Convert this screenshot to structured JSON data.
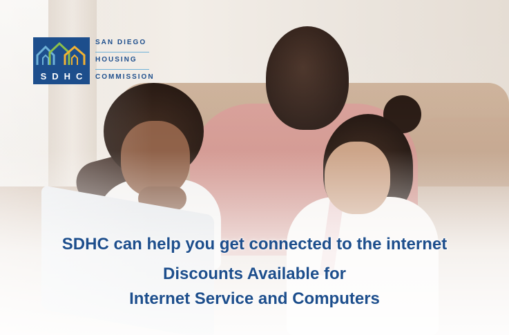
{
  "logo": {
    "letters": "SDHC",
    "line1": "SAN DIEGO",
    "line2": "HOUSING",
    "line3": "COMMISSION",
    "brand_color": "#1d4e8c",
    "accent_colors": [
      "#6fb2d8",
      "#8cc04a",
      "#f2b233"
    ]
  },
  "headline": {
    "line1": "SDHC can help you get connected to the internet",
    "line2": "Discounts Available for",
    "line3": "Internet Service and Computers"
  },
  "colors": {
    "text": "#1d4e8c"
  }
}
